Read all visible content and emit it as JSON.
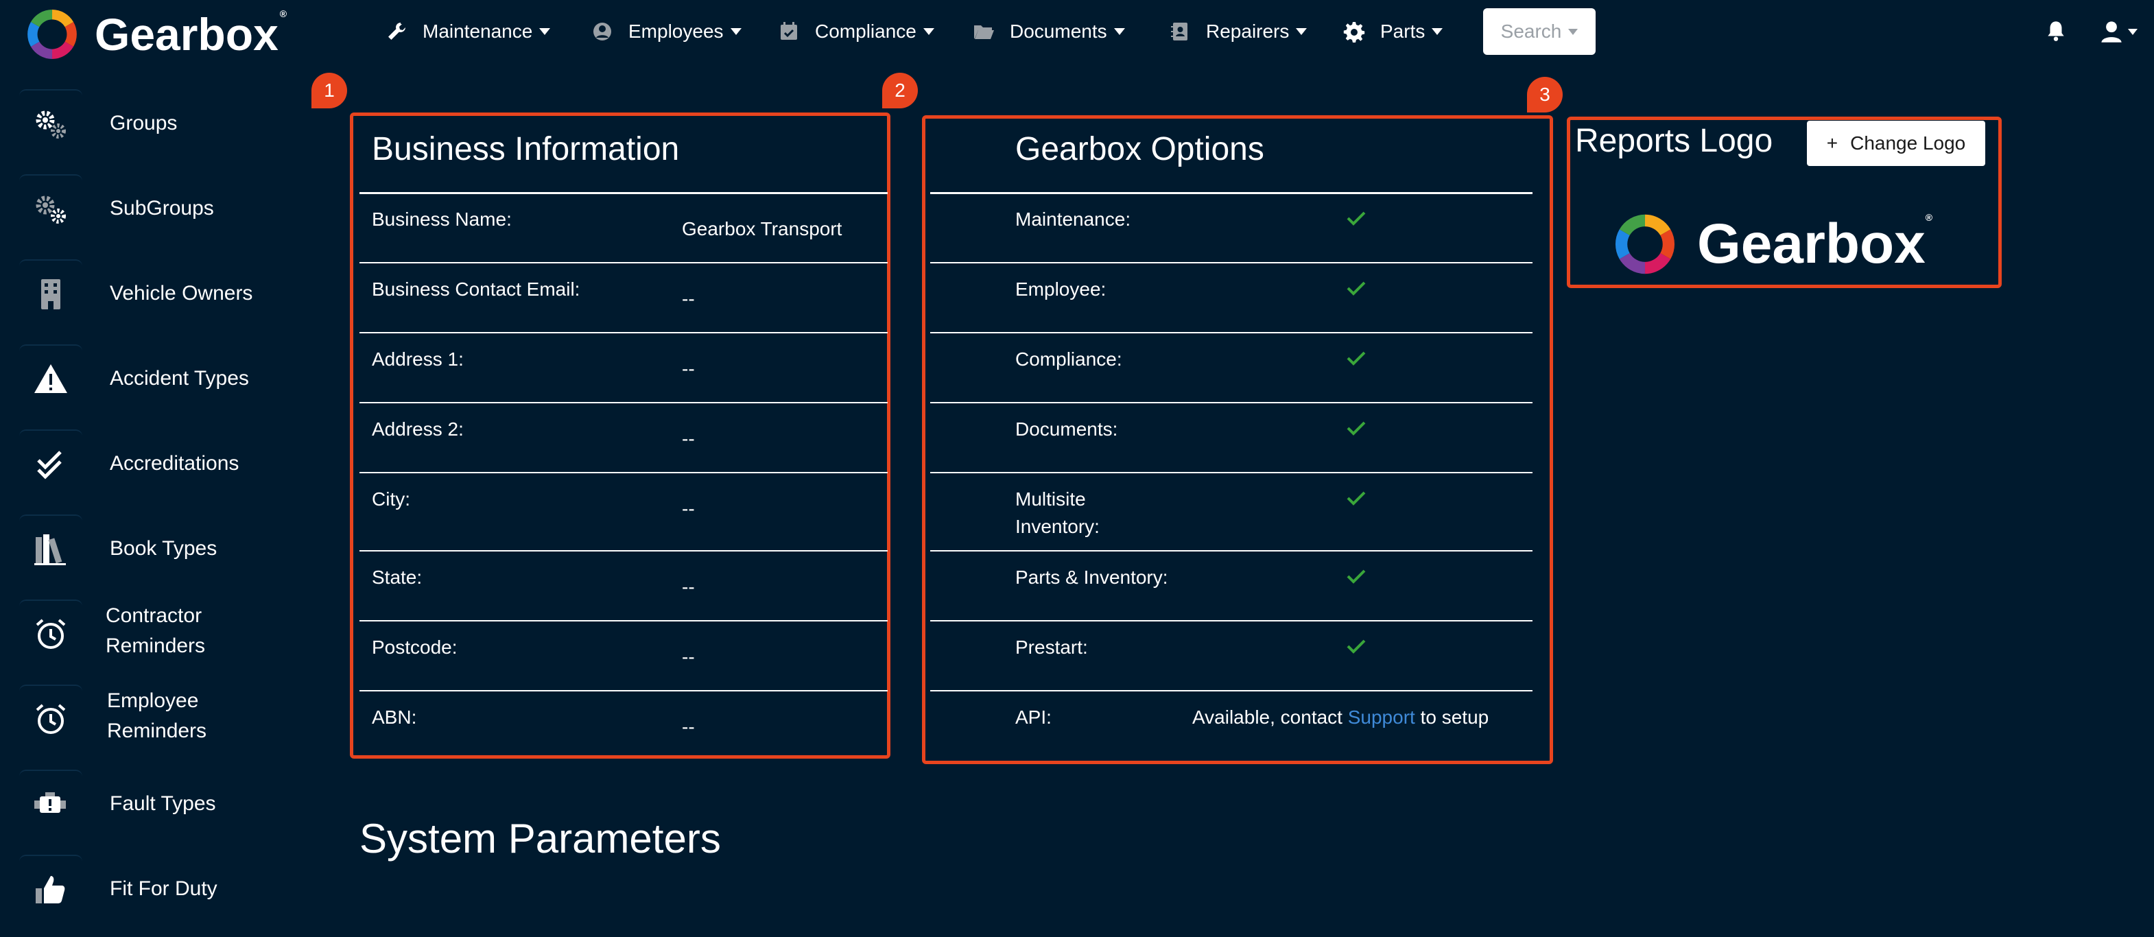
{
  "brand": {
    "name": "Gearbox",
    "trademark": "®"
  },
  "nav": {
    "maintenance": "Maintenance",
    "employees": "Employees",
    "compliance": "Compliance",
    "documents": "Documents",
    "repairers": "Repairers",
    "parts": "Parts",
    "search": "Search"
  },
  "sidebar": {
    "items": [
      {
        "label": "Groups",
        "icon": "gears-icon"
      },
      {
        "label": "SubGroups",
        "icon": "gears-icon"
      },
      {
        "label": "Vehicle Owners",
        "icon": "building-icon"
      },
      {
        "label": "Accident Types",
        "icon": "warning-icon"
      },
      {
        "label": "Accreditations",
        "icon": "double-check-icon"
      },
      {
        "label": "Book Types",
        "icon": "books-icon"
      },
      {
        "label": "Contractor",
        "label2": "Reminders",
        "icon": "alarm-clock-icon"
      },
      {
        "label": "Employee",
        "label2": "Reminders",
        "icon": "alarm-clock-icon"
      },
      {
        "label": "Fault Types",
        "icon": "engine-warning-icon"
      },
      {
        "label": "Fit For Duty",
        "icon": "thumbs-up-icon"
      }
    ]
  },
  "badges": [
    "1",
    "2",
    "3"
  ],
  "business": {
    "title": "Business Information",
    "rows": [
      {
        "label": "Business Name:",
        "value": "Gearbox Transport"
      },
      {
        "label": "Business Contact Email:",
        "value": "--"
      },
      {
        "label": "Address 1:",
        "value": "--"
      },
      {
        "label": "Address 2:",
        "value": "--"
      },
      {
        "label": "City:",
        "value": "--"
      },
      {
        "label": "State:",
        "value": "--"
      },
      {
        "label": "Postcode:",
        "value": "--"
      },
      {
        "label": "ABN:",
        "value": "--"
      }
    ]
  },
  "options": {
    "title": "Gearbox Options",
    "rows": [
      {
        "label": "Maintenance:"
      },
      {
        "label": "Employee:"
      },
      {
        "label": "Compliance:"
      },
      {
        "label": "Documents:"
      },
      {
        "label": "Multisite",
        "label2": "Inventory:"
      },
      {
        "label": "Parts & Inventory:"
      },
      {
        "label": "Prestart:"
      }
    ],
    "api": {
      "label": "API:",
      "before": "Available, contact ",
      "link": "Support",
      "after": " to setup"
    }
  },
  "reports": {
    "title": "Reports Logo",
    "change_plus": "+",
    "change_label": "Change Logo"
  },
  "system": {
    "title": "System Parameters"
  },
  "colors": {
    "background": "#001a2e",
    "accent": "#e8441e",
    "check": "#3aa63a",
    "link": "#3f8ad8"
  }
}
